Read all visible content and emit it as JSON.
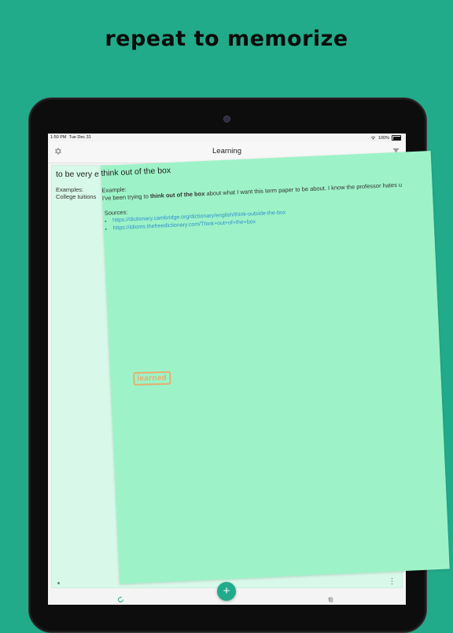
{
  "headline": "repeat to memorize",
  "status_bar": {
    "time": "1:50 PM",
    "date": "Tue Dec 31",
    "battery": "100%"
  },
  "nav": {
    "title": "Learning",
    "left_icon": "gear-icon",
    "right_icon": "filter-icon"
  },
  "back_card": {
    "title": "to be very e",
    "examples_label": "Examples:",
    "example_text": "College tuitions"
  },
  "front_card": {
    "title": "think out of the box",
    "example_label": "Example:",
    "example_prefix": "I've been trying to ",
    "example_bold": "think out of the box",
    "example_suffix": " about what I want this term paper to be about. I know the professor hates u",
    "sources_label": "Sources:",
    "sources": [
      "https://dictionary.cambridge.org/dictionary/english/think-outside-the-box",
      "https://idioms.thefreedictionary.com/Think+out+of+the+box"
    ],
    "stamp": "learned"
  },
  "fab": {
    "label": "+",
    "icon": "plus-icon"
  },
  "tabs": [
    {
      "icon": "refresh-icon"
    },
    {
      "icon": "cards-icon"
    }
  ],
  "colors": {
    "background": "#22ab8a",
    "front_card": "#9df3c7",
    "back_card": "#d8f8e9",
    "stamp": "#e8ad6f",
    "link": "#2f8fcf"
  }
}
